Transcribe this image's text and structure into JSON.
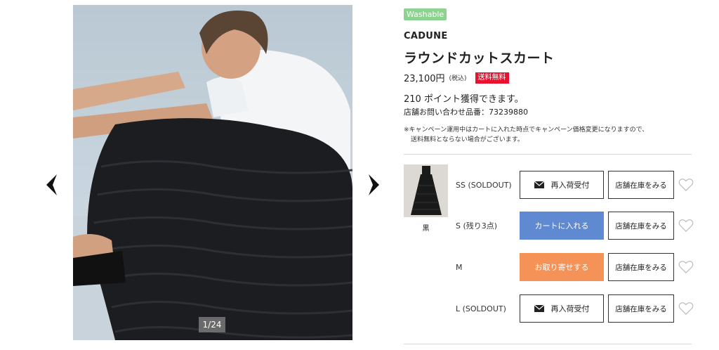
{
  "gallery": {
    "counter": "1/24",
    "prev_icon": "chevron-left-icon",
    "next_icon": "chevron-right-icon"
  },
  "product": {
    "badge": "Washable",
    "brand": "CADUNE",
    "title": "ラウンドカットスカート",
    "price": "23,100円",
    "tax_note": "(税込)",
    "shipping_badge": "送料無料",
    "points": "210 ポイント獲得できます。",
    "inquiry": "店舗お問い合わせ品番：73239880",
    "note_line1": "※キャンペーン運用中はカートに入れた時点でキャンペーン価格変更になりますので、",
    "note_line2": "送料無料とならない場合がございます。"
  },
  "variant": {
    "color_name": "黒",
    "sizes": [
      {
        "label": "SS (SOLDOUT)",
        "action": "再入荷受付",
        "store": "店舗在庫をみる"
      },
      {
        "label": "S (残り3点)",
        "action": "カートに入れる",
        "store": "店舗在庫をみる"
      },
      {
        "label": "M",
        "action": "お取り寄せする",
        "store": "店舗在庫をみる"
      },
      {
        "label": "L (SOLDOUT)",
        "action": "再入荷受付",
        "store": "店舗在庫をみる"
      }
    ]
  },
  "colors": {
    "washable": "#8cd38f",
    "shipping": "#e8112e",
    "cart_button": "#5f89d0",
    "order_button": "#f49258"
  }
}
